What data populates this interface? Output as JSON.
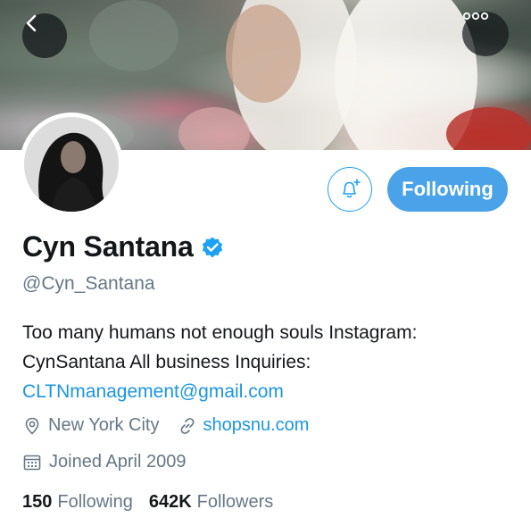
{
  "profile": {
    "name": "Cyn Santana",
    "handle": "@Cyn_Santana",
    "bio_text": "Too many humans not enough souls Instagram: CynSantana All business Inquiries:",
    "bio_email": "CLTNmanagement@gmail.com",
    "location": "New York City",
    "website": "shopsnu.com",
    "joined": "Joined April 2009",
    "verified": true
  },
  "actions": {
    "following_label": "Following"
  },
  "stats": {
    "following_count": "150",
    "following_label": "Following",
    "followers_count": "642K",
    "followers_label": "Followers"
  },
  "icons": {
    "back": "chevron-left-icon",
    "more": "more-dots-icon",
    "notify": "bell-plus-icon",
    "verified": "verified-badge-icon",
    "location": "location-pin-icon",
    "link": "link-icon",
    "calendar": "calendar-icon"
  },
  "colors": {
    "accent": "#1da1f2",
    "following_button": "#4aa3e8",
    "secondary_text": "#657786",
    "link": "#1b95e0"
  }
}
